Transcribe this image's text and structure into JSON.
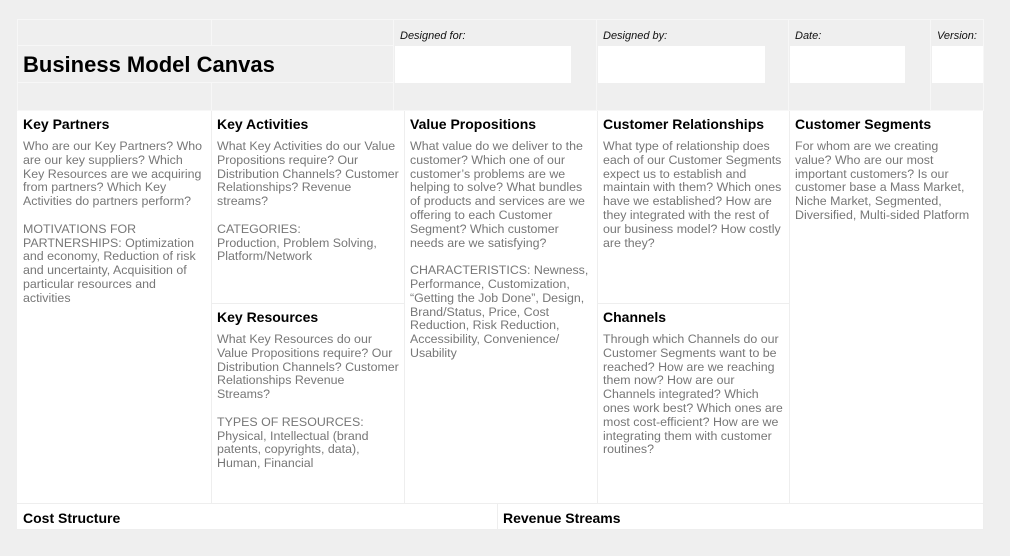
{
  "header": {
    "title": "Business Model Canvas",
    "fields": [
      {
        "label": "Designed for:",
        "value": ""
      },
      {
        "label": "Designed by:",
        "value": ""
      },
      {
        "label": "Date:",
        "value": ""
      },
      {
        "label": "Version:",
        "value": ""
      }
    ]
  },
  "blocks": {
    "key_partners": {
      "title": "Key Partners",
      "text": "Who are our Key Partners? Who are our key suppliers? Which Key Resources are we acquiring from partners? Which Key Activities do partners perform?\n\nMOTIVATIONS FOR PARTNERSHIPS: Optimization and economy, Reduction of risk and uncertainty, Acquisition of particular resources and activities"
    },
    "key_activities": {
      "title": "Key Activities",
      "text": "What Key Activities do our Value Propositions require? Our Distribution Channels? Customer Relationships? Revenue streams?\n\nCATEGORIES:\nProduction, Problem Solving, Platform/Network"
    },
    "key_resources": {
      "title": "Key Resources",
      "text": "What Key Resources do our Value Propositions require? Our Distribution Channels? Customer Relationships Revenue Streams?\n\nTYPES OF RESOURCES:\nPhysical, Intellectual (brand patents, copyrights, data), Human, Financial"
    },
    "value_propositions": {
      "title": "Value Propositions",
      "text": "What value do we deliver to the customer? Which one of our customer’s problems are we helping to solve? What bundles of products and services are we offering to each Customer Segment? Which customer needs are we satisfying?\n\nCHARACTERISTICS: Newness, Performance, Customization, “Getting the Job Done”, Design, Brand/Status, Price, Cost Reduction, Risk Reduction, Accessibility, Convenience/ Usability"
    },
    "customer_relationships": {
      "title": "Customer Relationships",
      "text": "What type of relationship does each of our Customer Segments expect us to establish and maintain with them? Which ones have we established? How are they integrated with the rest of our business model? How costly are they?"
    },
    "channels": {
      "title": "Channels",
      "text": "Through which Channels do our Customer Segments want to be reached? How are we reaching them now? How are our Channels integrated? Which ones work best? Which ones are most cost-efficient? How are we integrating them with customer routines?"
    },
    "customer_segments": {
      "title": "Customer Segments",
      "text": "For whom are we creating value? Who are our most important customers? Is our customer base a Mass Market, Niche Market, Segmented, Diversified, Multi-sided Platform"
    },
    "cost_structure": {
      "title": "Cost Structure",
      "text": ""
    },
    "revenue_streams": {
      "title": "Revenue Streams",
      "text": ""
    }
  }
}
